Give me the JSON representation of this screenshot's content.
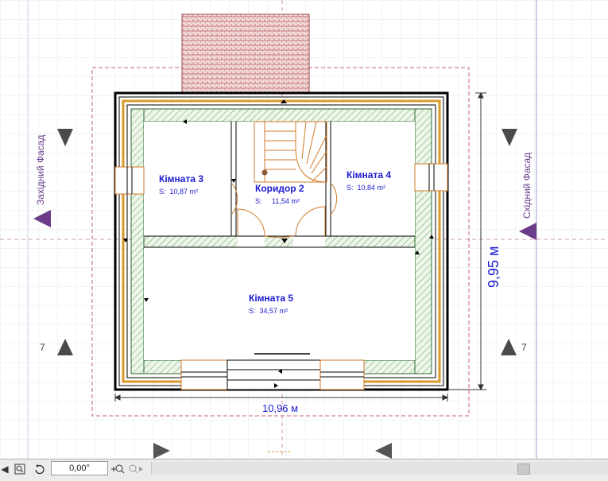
{
  "rooms": [
    {
      "name": "Кімната 3",
      "area_prefix": "S:",
      "area": "10,87 m²"
    },
    {
      "name": "Коридор 2",
      "area_prefix": "S:",
      "area": "11,54 m²"
    },
    {
      "name": "Кімната 4",
      "area_prefix": "S:",
      "area": "10,84 m²"
    },
    {
      "name": "Кімната 5",
      "area_prefix": "S:",
      "area": "34,57 m²"
    }
  ],
  "dimensions": {
    "width": "10,96 м",
    "height": "9,95 м"
  },
  "facades": {
    "west": "Західний Фасад",
    "east": "Східний Фасад"
  },
  "section_markers": {
    "left": "7",
    "right": "7"
  },
  "status_bar": {
    "angle_value": "0,00°"
  },
  "colors": {
    "wall": "#000000",
    "insulation": "#d99a2a",
    "hatch": "#3a8a3a",
    "room_text": "#1a1ad0",
    "facade_text": "#6a3c8a",
    "roof": "#b85a5a",
    "dimension": "#1a1ad0"
  },
  "icons": [
    "zoom-icon",
    "rotate-icon",
    "zoom-in-icon",
    "zoom-out-icon",
    "triangle-marker-icon"
  ]
}
